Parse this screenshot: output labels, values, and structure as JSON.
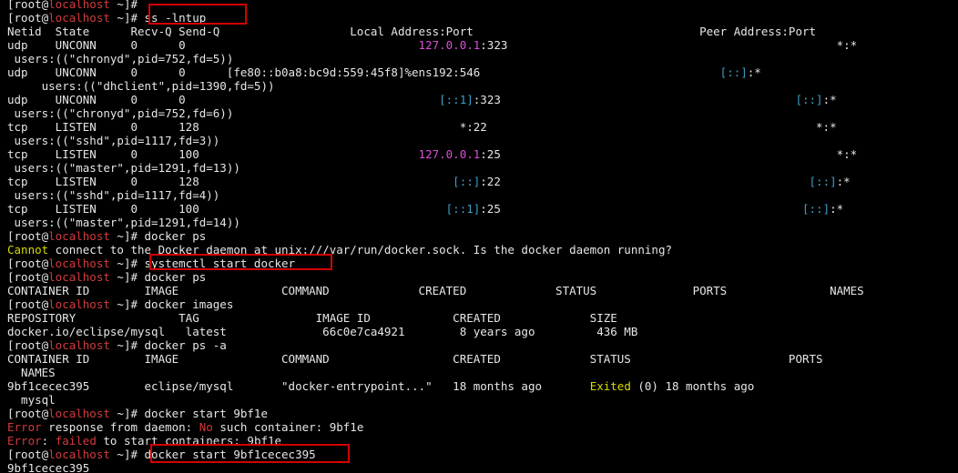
{
  "terminal": {
    "colors": {
      "background": "#000000",
      "text": "#e6e6e6",
      "hostname": "#d33a3a",
      "error": "#d33a3a",
      "yellow": "#cdcd00",
      "magenta": "#d850d8",
      "cyan": "#3c9fc8",
      "highlight": "#d40000"
    },
    "lines": [
      [
        [
          "[root@",
          "w"
        ],
        [
          "localhost",
          "r"
        ],
        [
          " ~]#",
          "w"
        ]
      ],
      [
        [
          "[root@",
          "w"
        ],
        [
          "localhost",
          "r"
        ],
        [
          " ~]# ss -lntup",
          "w"
        ]
      ],
      [
        [
          "Netid  State      Recv-Q Send-Q                   Local Address:Port                                 Peer Address:Port",
          "w"
        ]
      ],
      [
        [
          "udp    UNCONN     0      0                                  ",
          "w"
        ],
        [
          "127.0.0.1",
          "m"
        ],
        [
          ":323                                                *:*",
          "w"
        ]
      ],
      [
        [
          " users:((\"chronyd\",pid=752,fd=5))",
          "w"
        ]
      ],
      [
        [
          "udp    UNCONN     0      0      [fe80::b0a8:bc9d:559:45f8]%ens192:546                                   ",
          "w"
        ],
        [
          "[::]",
          "c"
        ],
        [
          ":*",
          "w"
        ]
      ],
      [
        [
          "     users:((\"dhclient\",pid=1390,fd=5))",
          "w"
        ]
      ],
      [
        [
          "udp    UNCONN     0      0                                     ",
          "w"
        ],
        [
          "[::1]",
          "c"
        ],
        [
          ":323                                           ",
          "w"
        ],
        [
          "[::]",
          "c"
        ],
        [
          ":*",
          "w"
        ]
      ],
      [
        [
          " users:((\"chronyd\",pid=752,fd=6))",
          "w"
        ]
      ],
      [
        [
          "tcp    LISTEN     0      128                                      *:22                                                *:*",
          "w"
        ]
      ],
      [
        [
          " users:((\"sshd\",pid=1117,fd=3))",
          "w"
        ]
      ],
      [
        [
          "tcp    LISTEN     0      100                                ",
          "w"
        ],
        [
          "127.0.0.1",
          "m"
        ],
        [
          ":25                                                 *:*",
          "w"
        ]
      ],
      [
        [
          " users:((\"master\",pid=1291,fd=13))",
          "w"
        ]
      ],
      [
        [
          "tcp    LISTEN     0      128                                     ",
          "w"
        ],
        [
          "[::]",
          "c"
        ],
        [
          ":22                                             ",
          "w"
        ],
        [
          "[::]",
          "c"
        ],
        [
          ":*",
          "w"
        ]
      ],
      [
        [
          " users:((\"sshd\",pid=1117,fd=4))",
          "w"
        ]
      ],
      [
        [
          "tcp    LISTEN     0      100                                    ",
          "w"
        ],
        [
          "[::1]",
          "c"
        ],
        [
          ":25                                            ",
          "w"
        ],
        [
          "[::]",
          "c"
        ],
        [
          ":*",
          "w"
        ]
      ],
      [
        [
          " users:((\"master\",pid=1291,fd=14))",
          "w"
        ]
      ],
      [
        [
          "[root@",
          "w"
        ],
        [
          "localhost",
          "r"
        ],
        [
          " ~]# docker ps",
          "w"
        ]
      ],
      [
        [
          "Cannot",
          "y"
        ],
        [
          " connect to the Docker daemon at unix:///var/run/docker.sock. Is the docker daemon running?",
          "w"
        ]
      ],
      [
        [
          "[root@",
          "w"
        ],
        [
          "localhost",
          "r"
        ],
        [
          " ~]# systemctl start docker",
          "w"
        ]
      ],
      [
        [
          "[root@",
          "w"
        ],
        [
          "localhost",
          "r"
        ],
        [
          " ~]# docker ps",
          "w"
        ]
      ],
      [
        [
          "CONTAINER ID        IMAGE               COMMAND             CREATED             STATUS              PORTS               NAMES",
          "w"
        ]
      ],
      [
        [
          "[root@",
          "w"
        ],
        [
          "localhost",
          "r"
        ],
        [
          " ~]# docker images",
          "w"
        ]
      ],
      [
        [
          "REPOSITORY               TAG                 IMAGE ID            CREATED             SIZE",
          "w"
        ]
      ],
      [
        [
          "docker.io/eclipse/mysql   latest              66c0e7ca4921        8 years ago         436 MB",
          "w"
        ]
      ],
      [
        [
          "[root@",
          "w"
        ],
        [
          "localhost",
          "r"
        ],
        [
          " ~]# docker ps -a",
          "w"
        ]
      ],
      [
        [
          "CONTAINER ID        IMAGE               COMMAND                  CREATED             STATUS                       PORTS",
          "w"
        ]
      ],
      [
        [
          "  NAMES",
          "w"
        ]
      ],
      [
        [
          "9bf1cecec395        eclipse/mysql       \"docker-entrypoint...\"   18 months ago       ",
          "w"
        ],
        [
          "Exited",
          "y"
        ],
        [
          " (0) 18 months ago",
          "w"
        ]
      ],
      [
        [
          "  mysql",
          "w"
        ]
      ],
      [
        [
          "[root@",
          "w"
        ],
        [
          "localhost",
          "r"
        ],
        [
          " ~]# docker start 9bf1e",
          "w"
        ]
      ],
      [
        [
          "Error",
          "r"
        ],
        [
          " response from daemon: ",
          "w"
        ],
        [
          "No",
          "r"
        ],
        [
          " such container: 9bf1e",
          "w"
        ]
      ],
      [
        [
          "Error",
          "r"
        ],
        [
          ": ",
          "w"
        ],
        [
          "failed",
          "r"
        ],
        [
          " to start containers: 9bf1e",
          "w"
        ]
      ],
      [
        [
          "[root@",
          "w"
        ],
        [
          "localhost",
          "r"
        ],
        [
          " ~]# docker start 9bf1cecec395",
          "w"
        ]
      ],
      [
        [
          "9bf1cecec395",
          "w"
        ]
      ]
    ],
    "highlighted_commands": [
      "ss -lntup",
      "systemctl start docker",
      "docker start 9bf1cecec395"
    ]
  }
}
